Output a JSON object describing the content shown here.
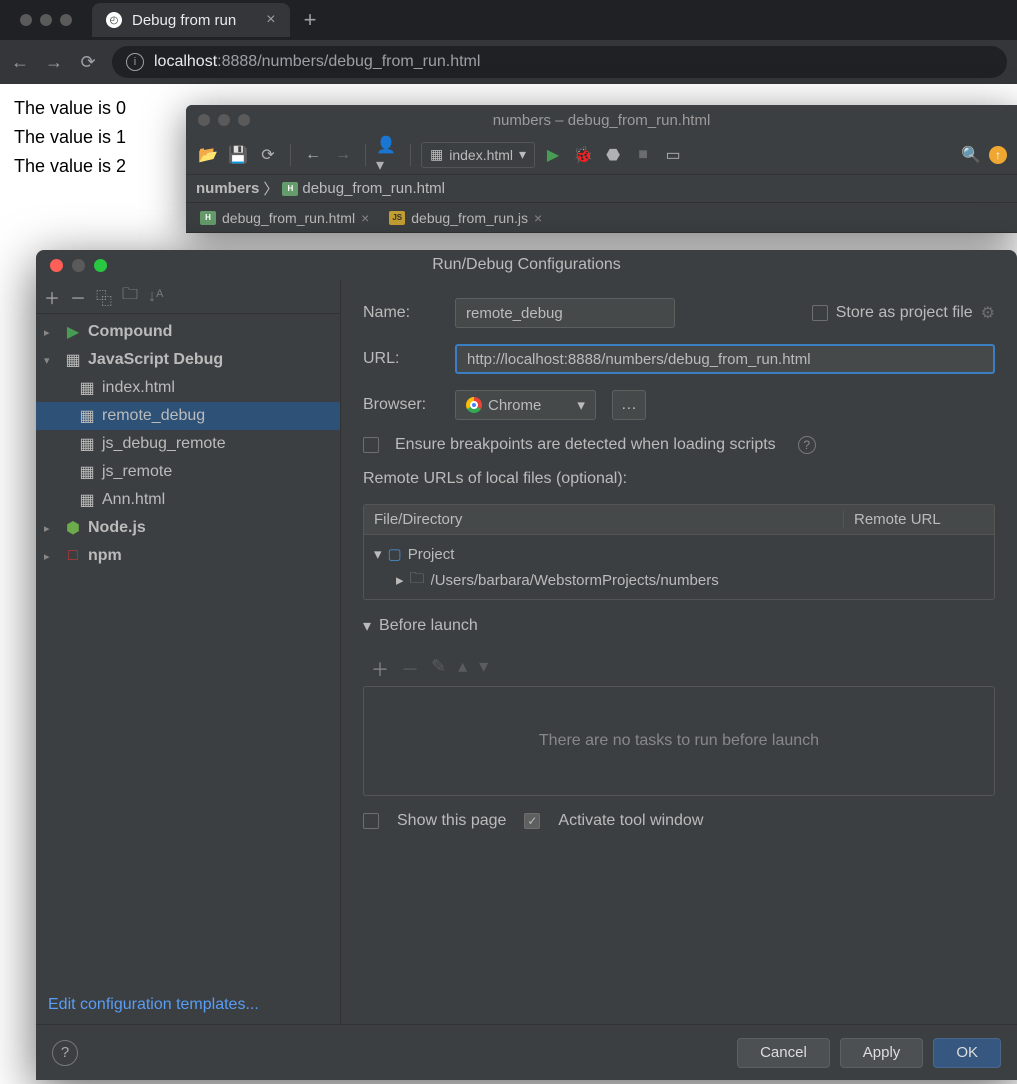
{
  "browser": {
    "tab_title": "Debug from run",
    "url_display_prefix": "localhost",
    "url_display_suffix": ":8888/numbers/debug_from_run.html",
    "page_lines": [
      "The value is 0",
      "The value is 1",
      "The value is 2"
    ]
  },
  "ide": {
    "title": "numbers – debug_from_run.html",
    "run_config_selected": "index.html",
    "breadcrumb_root": "numbers",
    "breadcrumb_file": "debug_from_run.html",
    "tabs": [
      {
        "name": "debug_from_run.html",
        "type": "html"
      },
      {
        "name": "debug_from_run.js",
        "type": "js"
      }
    ]
  },
  "dialog": {
    "title": "Run/Debug Configurations",
    "tree": {
      "compound": "Compound",
      "jsdebug": "JavaScript Debug",
      "jsdebug_items": [
        "index.html",
        "remote_debug",
        "js_debug_remote",
        "js_remote",
        "Ann.html"
      ],
      "selected": "remote_debug",
      "nodejs": "Node.js",
      "npm": "npm"
    },
    "edit_templates": "Edit configuration templates...",
    "form": {
      "name_label": "Name:",
      "name_value": "remote_debug",
      "store_label": "Store as project file",
      "url_label": "URL:",
      "url_value": "http://localhost:8888/numbers/debug_from_run.html",
      "browser_label": "Browser:",
      "browser_value": "Chrome",
      "ensure_bp": "Ensure breakpoints are detected when loading scripts",
      "remote_urls_label": "Remote URLs of local files (optional):",
      "table_h1": "File/Directory",
      "table_h2": "Remote URL",
      "project_label": "Project",
      "project_path": "/Users/barbara/WebstormProjects/numbers",
      "before_launch": "Before launch",
      "no_tasks": "There are no tasks to run before launch",
      "show_page": "Show this page",
      "activate_tw": "Activate tool window"
    },
    "buttons": {
      "cancel": "Cancel",
      "apply": "Apply",
      "ok": "OK"
    }
  }
}
